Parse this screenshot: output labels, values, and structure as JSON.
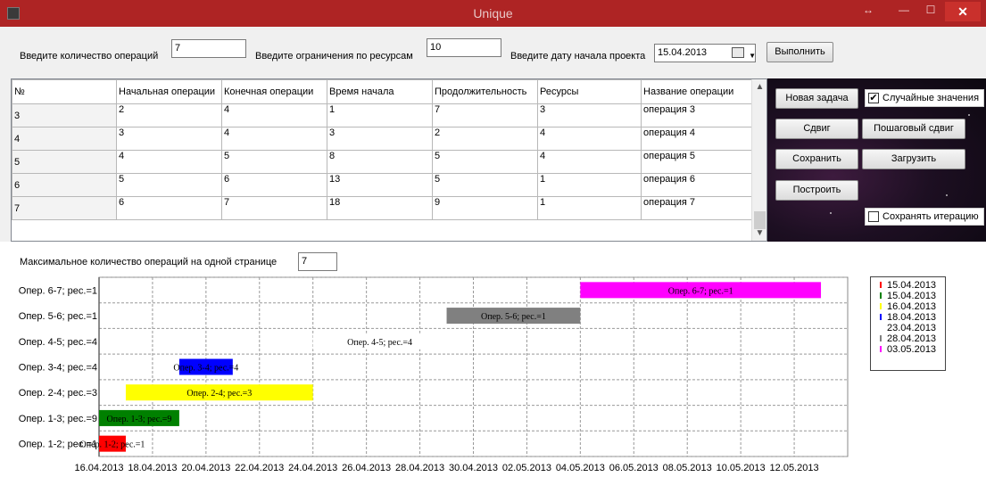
{
  "window": {
    "title": "Unique",
    "close_glyph": "✕",
    "restore_glyph": "↔",
    "minimize_glyph": "—",
    "maximize_glyph": "☐"
  },
  "toolbar": {
    "ops_label": "Введите количество операций",
    "ops_value": "7",
    "res_label": "Введите ограничения по ресурсам",
    "res_value": "10",
    "date_label": "Введите дату начала проекта",
    "date_value": "15.04.2013",
    "run_button": "Выполнить"
  },
  "grid": {
    "columns": [
      "№",
      "Начальная операции",
      "Конечная операции",
      "Время начала",
      "Продолжительность",
      "Ресурсы",
      "Название операции"
    ],
    "rows": [
      {
        "num": "3",
        "start": "2",
        "end": "4",
        "time": "1",
        "dur": "7",
        "res": "3",
        "name": "операция 3"
      },
      {
        "num": "4",
        "start": "3",
        "end": "4",
        "time": "3",
        "dur": "2",
        "res": "4",
        "name": "операция 4"
      },
      {
        "num": "5",
        "start": "4",
        "end": "5",
        "time": "8",
        "dur": "5",
        "res": "4",
        "name": "операция 5"
      },
      {
        "num": "6",
        "start": "5",
        "end": "6",
        "time": "13",
        "dur": "5",
        "res": "1",
        "name": "операция 6"
      },
      {
        "num": "7",
        "start": "6",
        "end": "7",
        "time": "18",
        "dur": "9",
        "res": "1",
        "name": "операция 7"
      }
    ]
  },
  "panel": {
    "new_task": "Новая задача",
    "random_values": "Случайные значения",
    "random_checked": true,
    "shift": "Сдвиг",
    "step_shift": "Пошаговый сдвиг",
    "save": "Сохранить",
    "load": "Загрузить",
    "build": "Построить",
    "save_iteration": "Сохранять итерацию",
    "save_iteration_checked": false
  },
  "page_limit": {
    "label": "Максимальное количество операций на одной странице",
    "value": "7"
  },
  "chart_data": {
    "type": "bar",
    "orientation": "horizontal-gantt",
    "categories": [
      "Опер. 1-2; рес.=1",
      "Опер. 1-3; рес.=9",
      "Опер. 2-4; рес.=3",
      "Опер. 3-4; рес.=4",
      "Опер. 4-5; рес.=4",
      "Опер. 5-6; рес.=1",
      "Опер. 6-7; рес.=1"
    ],
    "bars": [
      {
        "label": "Опер. 1-2; рес.=1",
        "start": "16.04.2013",
        "end": "17.04.2013",
        "color": "#ff0000"
      },
      {
        "label": "Опер. 1-3; рес.=9",
        "start": "16.04.2013",
        "end": "19.04.2013",
        "color": "#008000"
      },
      {
        "label": "Опер. 2-4; рес.=3",
        "start": "17.04.2013",
        "end": "24.04.2013",
        "color": "#ffff00"
      },
      {
        "label": "Опер. 3-4; рес.=4",
        "start": "19.04.2013",
        "end": "21.04.2013",
        "color": "#0000ff"
      },
      {
        "label": "Опер. 4-5; рес.=4",
        "start": "24.04.2013",
        "end": "29.04.2013",
        "color": "#ffffff"
      },
      {
        "label": "Опер. 5-6; рес.=1",
        "start": "29.04.2013",
        "end": "04.05.2013",
        "color": "#808080"
      },
      {
        "label": "Опер. 6-7; рес.=1",
        "start": "04.05.2013",
        "end": "13.05.2013",
        "color": "#ff00ff"
      }
    ],
    "x_ticks": [
      "16.04.2013",
      "18.04.2013",
      "20.04.2013",
      "22.04.2013",
      "24.04.2013",
      "26.04.2013",
      "28.04.2013",
      "30.04.2013",
      "02.05.2013",
      "04.05.2013",
      "06.05.2013",
      "08.05.2013",
      "10.05.2013",
      "12.05.2013"
    ],
    "xlim": [
      "16.04.2013",
      "14.05.2013"
    ],
    "grid": true,
    "legend_position": "right",
    "legend": [
      {
        "label": "15.04.2013",
        "color": "#ff0000"
      },
      {
        "label": "15.04.2013",
        "color": "#008000"
      },
      {
        "label": "16.04.2013",
        "color": "#ffff00"
      },
      {
        "label": "18.04.2013",
        "color": "#0000ff"
      },
      {
        "label": "23.04.2013",
        "color": "#ffffff"
      },
      {
        "label": "28.04.2013",
        "color": "#808080"
      },
      {
        "label": "03.05.2013",
        "color": "#ff00ff"
      }
    ]
  }
}
